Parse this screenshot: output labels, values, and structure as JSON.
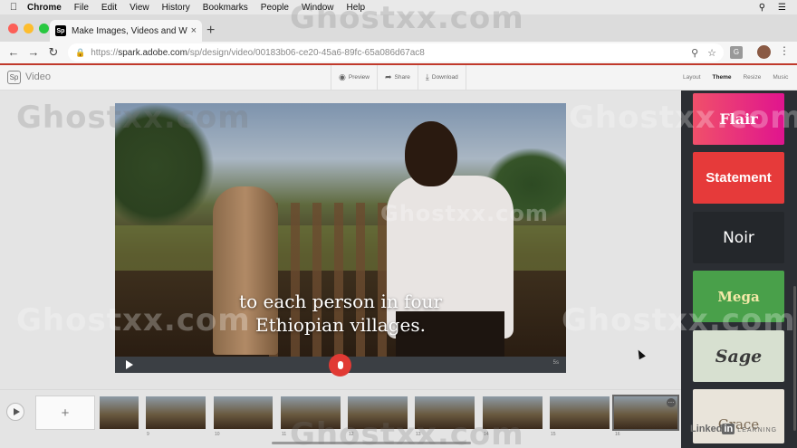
{
  "menubar": {
    "app": "Chrome",
    "items": [
      "File",
      "Edit",
      "View",
      "History",
      "Bookmarks",
      "People",
      "Window",
      "Help"
    ]
  },
  "browser": {
    "tab_title": "Make Images, Videos and Web",
    "tab_favicon": "Sp",
    "url_prefix": "https://",
    "url_host": "spark.adobe.com",
    "url_path": "/sp/design/video/00183b06-ce20-45a6-89fc-65a086d67ac8",
    "extension_label": "G"
  },
  "app": {
    "logo": "Sp",
    "name": "Video",
    "actions": [
      {
        "label": "Preview",
        "icon": "eye-icon"
      },
      {
        "label": "Share",
        "icon": "share-icon"
      },
      {
        "label": "Download",
        "icon": "download-icon"
      }
    ],
    "nav": [
      "Layout",
      "Theme",
      "Resize",
      "Music"
    ],
    "active_nav": "Theme"
  },
  "video": {
    "caption_line1": "to each person in four",
    "caption_line2": "Ethiopian villages.",
    "duration": "5s"
  },
  "themes": [
    {
      "name": "Flair",
      "bg": "#e2207a",
      "fg": "#ffffff",
      "font": "serif"
    },
    {
      "name": "Statement",
      "bg": "#e63a3a",
      "fg": "#ffffff",
      "font": "sans"
    },
    {
      "name": "Noir",
      "bg": "#24272b",
      "fg": "#ffffff",
      "font": "sans"
    },
    {
      "name": "Mega",
      "bg": "#49a04a",
      "fg": "#f4e9a8",
      "font": "serif"
    },
    {
      "name": "Sage",
      "bg": "#d7e0d0",
      "fg": "#3a3a3a",
      "font": "script"
    },
    {
      "name": "Grace",
      "bg": "#e9e4da",
      "fg": "#7b6a55",
      "font": "serif"
    }
  ],
  "filmstrip": {
    "add_label": "+",
    "thumbs": [
      {
        "num": "",
        "cap": ""
      },
      {
        "num": "9",
        "cap": ""
      },
      {
        "num": "10",
        "cap": ""
      },
      {
        "num": "11",
        "cap": ""
      },
      {
        "num": "12",
        "cap": ""
      },
      {
        "num": "13",
        "cap": ""
      },
      {
        "num": "14",
        "cap": ""
      },
      {
        "num": "15",
        "cap": ""
      },
      {
        "num": "16",
        "cap": ""
      }
    ]
  },
  "watermark": "Ghostxx.com",
  "branding": {
    "a": "Linked",
    "b": "in",
    "c": "LEARNING"
  }
}
